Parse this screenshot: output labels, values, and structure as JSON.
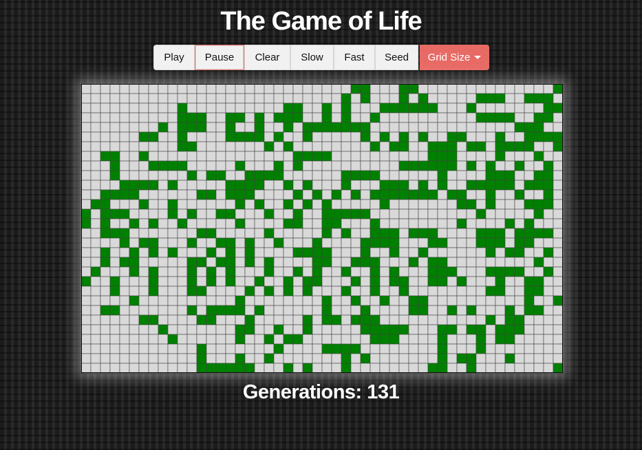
{
  "title": "The Game of Life",
  "toolbar": {
    "play_label": "Play",
    "pause_label": "Pause",
    "clear_label": "Clear",
    "slow_label": "Slow",
    "fast_label": "Fast",
    "seed_label": "Seed",
    "grid_size_label": "Grid Size"
  },
  "grid": {
    "rows": 30,
    "cols": 50,
    "alive_color": "#008000",
    "dead_color": "#d9d9d9",
    "line_color": "#444444",
    "cells": [
      "............................##...##..............##",
      "...........................#.#...#.#.....###..###.#",
      "..........#..........##..#.#...######...#.......##.",
      "..........###..##.#.###..#.#..#..........####..##.#",
      "........#.###..#..#..#.#######...............###..#",
      "......##..#....####.#..#.....#.#.#.#..##...#..####.",
      "..........##.......#.#........#.##..###.##.####..##",
      "..##..#...............####..........###....#...#...",
      "...#...####.....#...#.#..........######.#.#..#..#..",
      "...#.......#.##..####......####......#....###..##..",
      "....####.#.....####..#.#...#...###.#.#..#####.###..",
      "..####......##.###....#.#.#.#.#######.##..#..#..#..",
      ".##...#..#......#.#..#.#.#.....#.......##.#...###..",
      "#.###....#.#..##...#..#..#####...........#.....#...",
      "#.#..#.#..#.....#....##..##...#........#....#.#....",
      "..###.......##.....#.....#.#..###.###....###.####..",
      "....#.##...#..##.#..#...#....####...##...###.##....",
      "..#..#.#.#...#.#.#....####...#..#..#......#.##..#..",
      "..#.##.....##.##.#.#....##..###...#.##.........#...",
      ".#...#.#...#.#.#...#..#.#..#..#.#...###...####..#..",
      "#..#...#...#.#.#..#..#.##...#.#.##..##.#...#..##...",
      "...#...#...##....#.#.#.#...#..#..#........##..##...",
      ".....#..........#........#..#..#..##..........#..#.",
      "..##.......#.####.#......#...#....##..#.#...#.##..#",
      "......##....##...#.....#.##.###...........#.##.....",
      "........#.......##..#..#.....#####...##.##.###.....",
      ".........#......#..#.##.......###....#...#.##......",
      "............#.......#....####........#...#.........",
      "............#...#..#.......#.#.......#.##...#......",
      "............######...#.#...#........##..#........##"
    ]
  },
  "status": {
    "generations_text": "Generations: 131"
  }
}
